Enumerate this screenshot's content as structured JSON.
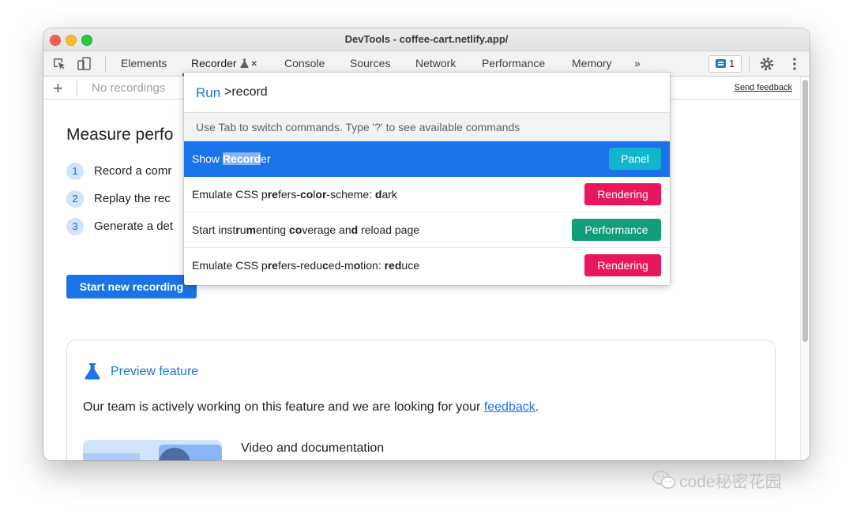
{
  "window": {
    "title": "DevTools - coffee-cart.netlify.app/"
  },
  "tabs": [
    {
      "label": "Elements"
    },
    {
      "label": "Recorder"
    },
    {
      "label": "Console"
    },
    {
      "label": "Sources"
    },
    {
      "label": "Network"
    },
    {
      "label": "Performance"
    },
    {
      "label": "Memory"
    }
  ],
  "tab_overflow": "»",
  "close_glyph": "×",
  "issues_count": "1",
  "toolbar": {
    "recordings_placeholder": "No recordings",
    "send_feedback": "Send feedback"
  },
  "page": {
    "heading": "Measure perfo",
    "steps": [
      {
        "num": "1",
        "text": "Record a comr"
      },
      {
        "num": "2",
        "text": "Replay the rec"
      },
      {
        "num": "3",
        "text": "Generate a det"
      }
    ],
    "start_button": "Start new recording",
    "preview": {
      "title": "Preview feature",
      "text": "Our team is actively working on this feature and we are looking for your",
      "link": "feedback",
      "period": ".",
      "video_title": "Video and documentation"
    }
  },
  "palette": {
    "prefix": "Run",
    "query": ">record",
    "hint": "Use Tab to switch commands. Type '?' to see available commands",
    "commands": [
      {
        "parts": [
          "Show ",
          "Record",
          "er"
        ],
        "badge": "Panel",
        "badge_color": "#12b5cb"
      },
      {
        "parts": [
          "Emulate CSS p",
          "re",
          "fers-",
          "co",
          "l",
          "or",
          "-scheme: ",
          "d",
          "ark"
        ],
        "badge": "Rendering",
        "badge_color": "#e8175d"
      },
      {
        "parts": [
          "Start inst",
          "r",
          "u",
          "m",
          "enting ",
          "co",
          "verage an",
          "d",
          " reload page"
        ],
        "badge": "Performance",
        "badge_color": "#0f9d7a"
      },
      {
        "parts": [
          "Emulate CSS p",
          "re",
          "fers-redu",
          "c",
          "ed-m",
          "o",
          "tion: ",
          "red",
          "uce"
        ],
        "badge": "Rendering",
        "badge_color": "#e8175d"
      }
    ]
  },
  "watermark": "code秘密花园"
}
